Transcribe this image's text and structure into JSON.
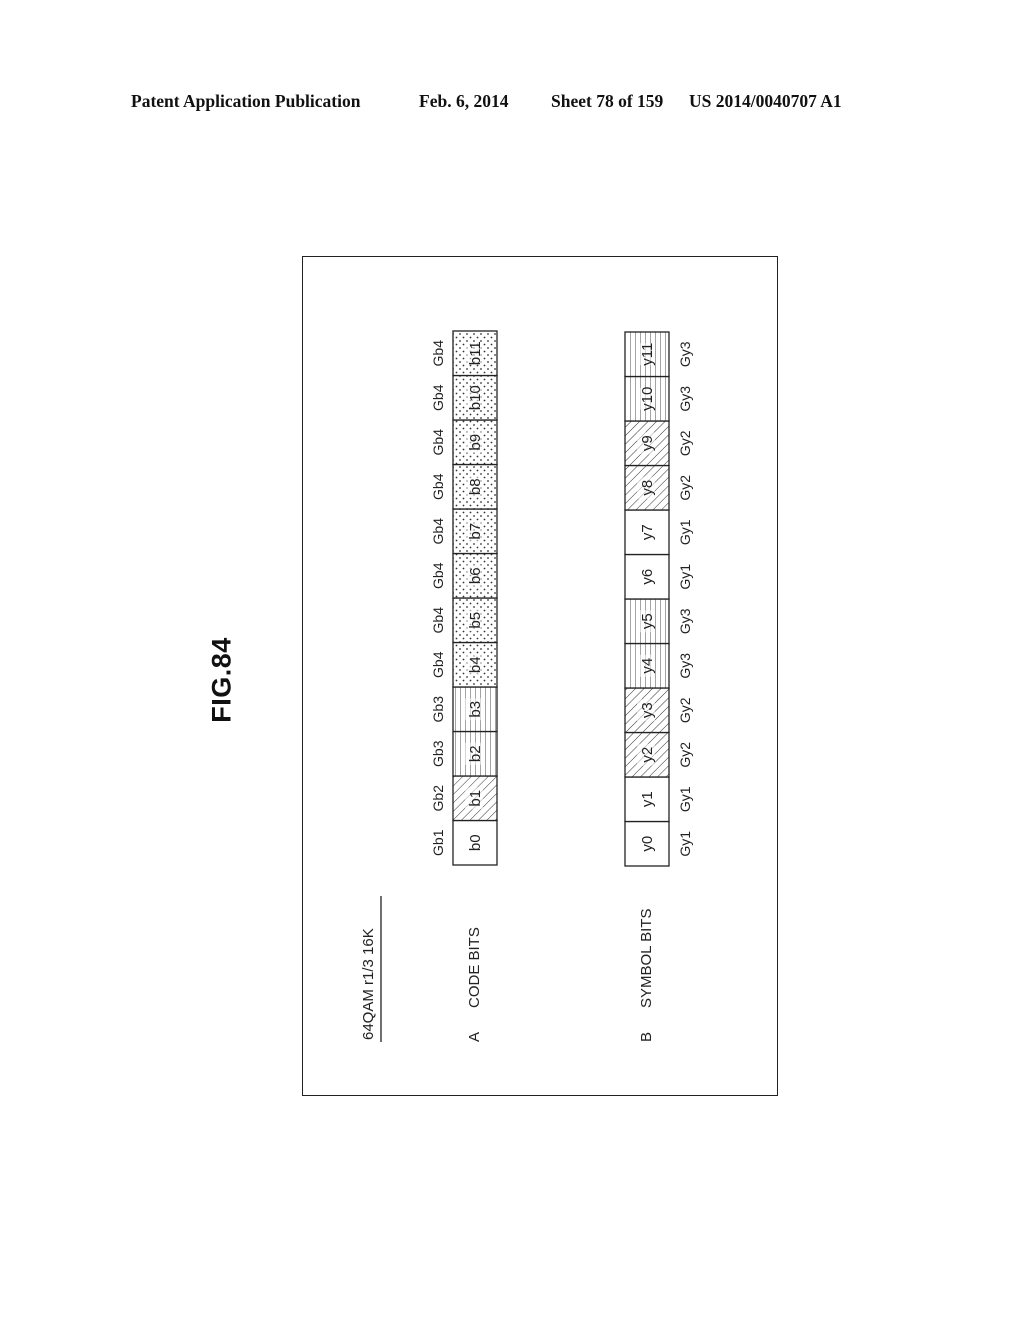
{
  "header": {
    "publication": "Patent Application Publication",
    "date": "Feb. 6, 2014",
    "sheet": "Sheet 78 of 159",
    "number": "US 2014/0040707 A1"
  },
  "figure": {
    "label": "FIG.84",
    "title": "64QAM  r1/3  16K",
    "sections": [
      {
        "letter": "A",
        "name": "CODE BITS",
        "cells": [
          {
            "label": "b0",
            "group": "Gb1",
            "pattern": "blank"
          },
          {
            "label": "b1",
            "group": "Gb2",
            "pattern": "diagonal"
          },
          {
            "label": "b2",
            "group": "Gb3",
            "pattern": "horizontal"
          },
          {
            "label": "b3",
            "group": "Gb3",
            "pattern": "horizontal"
          },
          {
            "label": "b4",
            "group": "Gb4",
            "pattern": "dots"
          },
          {
            "label": "b5",
            "group": "Gb4",
            "pattern": "dots"
          },
          {
            "label": "b6",
            "group": "Gb4",
            "pattern": "dots"
          },
          {
            "label": "b7",
            "group": "Gb4",
            "pattern": "dots"
          },
          {
            "label": "b8",
            "group": "Gb4",
            "pattern": "dots"
          },
          {
            "label": "b9",
            "group": "Gb4",
            "pattern": "dots"
          },
          {
            "label": "b10",
            "group": "Gb4",
            "pattern": "dots"
          },
          {
            "label": "b11",
            "group": "Gb4",
            "pattern": "dots"
          }
        ]
      },
      {
        "letter": "B",
        "name": "SYMBOL BITS",
        "cells": [
          {
            "label": "y0",
            "group": "Gy1",
            "pattern": "blank"
          },
          {
            "label": "y1",
            "group": "Gy1",
            "pattern": "blank"
          },
          {
            "label": "y2",
            "group": "Gy2",
            "pattern": "diagonal"
          },
          {
            "label": "y3",
            "group": "Gy2",
            "pattern": "diagonal"
          },
          {
            "label": "y4",
            "group": "Gy3",
            "pattern": "horizontal"
          },
          {
            "label": "y5",
            "group": "Gy3",
            "pattern": "horizontal"
          },
          {
            "label": "y6",
            "group": "Gy1",
            "pattern": "blank"
          },
          {
            "label": "y7",
            "group": "Gy1",
            "pattern": "blank"
          },
          {
            "label": "y8",
            "group": "Gy2",
            "pattern": "diagonal"
          },
          {
            "label": "y9",
            "group": "Gy2",
            "pattern": "diagonal"
          },
          {
            "label": "y10",
            "group": "Gy3",
            "pattern": "horizontal"
          },
          {
            "label": "y11",
            "group": "Gy3",
            "pattern": "horizontal"
          }
        ]
      }
    ]
  }
}
